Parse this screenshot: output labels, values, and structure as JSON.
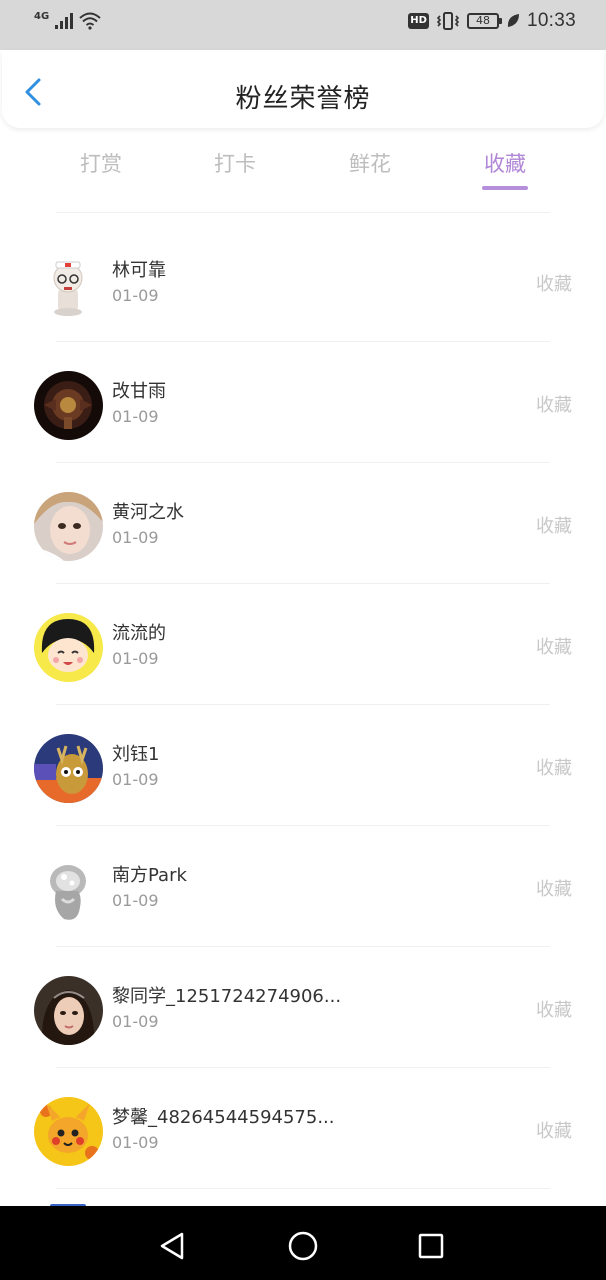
{
  "status_bar": {
    "network": "4G",
    "hd": "HD",
    "battery": "48",
    "time": "10:33"
  },
  "header": {
    "title": "粉丝荣誉榜"
  },
  "tabs": [
    {
      "label": "打赏"
    },
    {
      "label": "打卡"
    },
    {
      "label": "鲜花"
    },
    {
      "label": "收藏",
      "active": true
    }
  ],
  "list": [
    {
      "name": "林可靠",
      "date": "01-09",
      "action": "收藏"
    },
    {
      "name": "改甘雨",
      "date": "01-09",
      "action": "收藏"
    },
    {
      "name": "黄河之水",
      "date": "01-09",
      "action": "收藏"
    },
    {
      "name": "流流的",
      "date": "01-09",
      "action": "收藏"
    },
    {
      "name": "刘钰1",
      "date": "01-09",
      "action": "收藏"
    },
    {
      "name": "南方Park",
      "date": "01-09",
      "action": "收藏"
    },
    {
      "name": "黎同学_1251724274906...",
      "date": "01-09",
      "action": "收藏"
    },
    {
      "name": "梦馨_48264544594575...",
      "date": "01-09",
      "action": "收藏"
    }
  ],
  "colors": {
    "accent": "#b58fdb",
    "back_arrow": "#2f8fe0",
    "inactive_tab": "#bdbdbd"
  }
}
